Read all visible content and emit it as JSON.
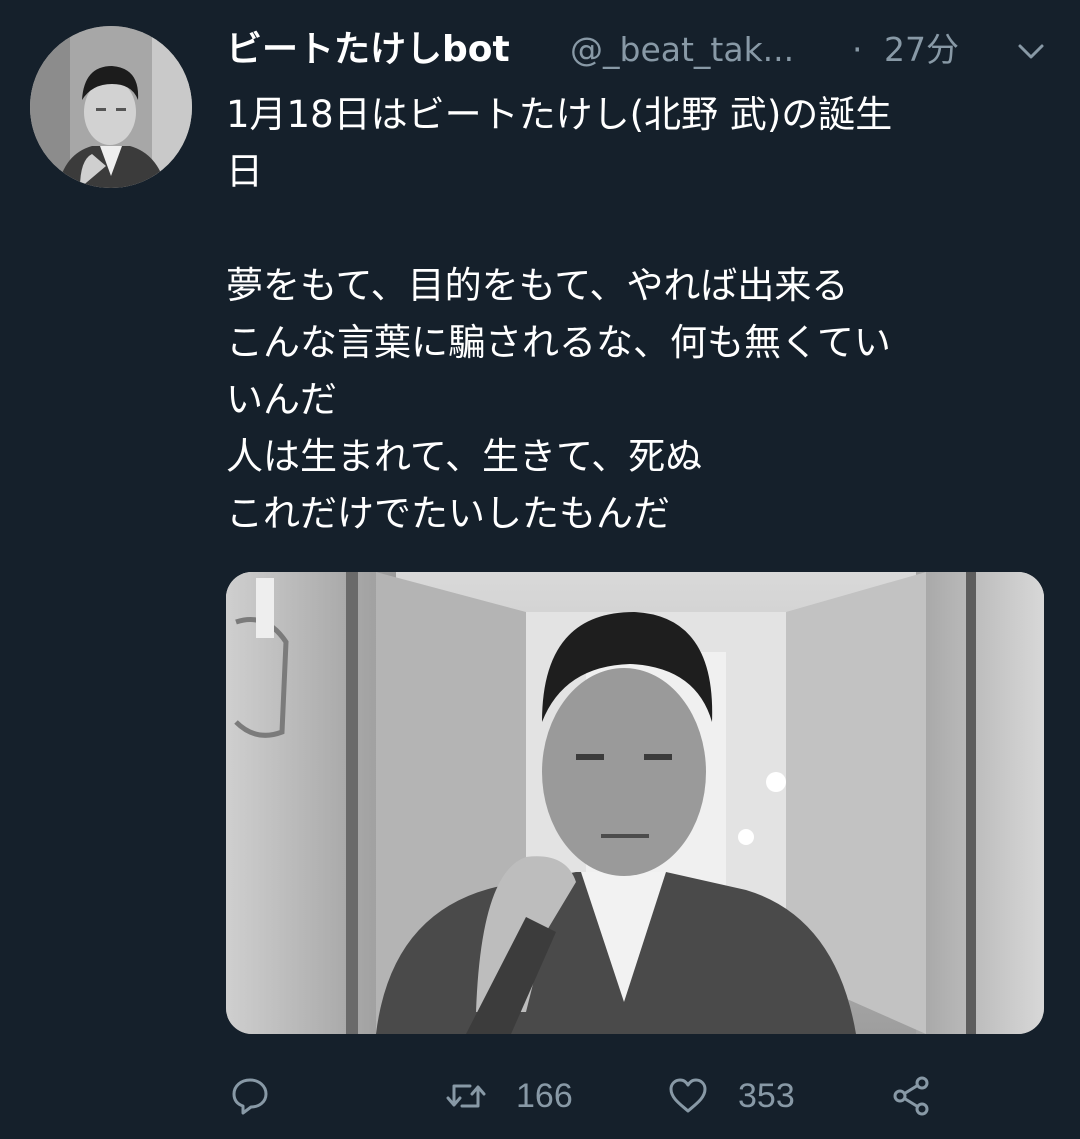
{
  "tweet": {
    "display_name": "ビートたけしbot",
    "handle": "@_beat_tak...",
    "separator": "·",
    "time": "27分",
    "text_lines": [
      "1月18日はビートたけし(北野 武)の誕生",
      "日",
      "",
      "夢をもて、目的をもて、やれば出来る",
      "こんな言葉に騙されるな、何も無くてい",
      "いんだ",
      "人は生まれて、生きて、死ぬ",
      "これだけでたいしたもんだ"
    ]
  },
  "actions": {
    "reply_icon": "reply-icon",
    "retweet_icon": "retweet-icon",
    "retweet_count": "166",
    "like_icon": "heart-icon",
    "like_count": "353",
    "share_icon": "share-icon"
  },
  "colors": {
    "background": "#15202b",
    "text_primary": "#ffffff",
    "text_secondary": "#8899a6"
  }
}
